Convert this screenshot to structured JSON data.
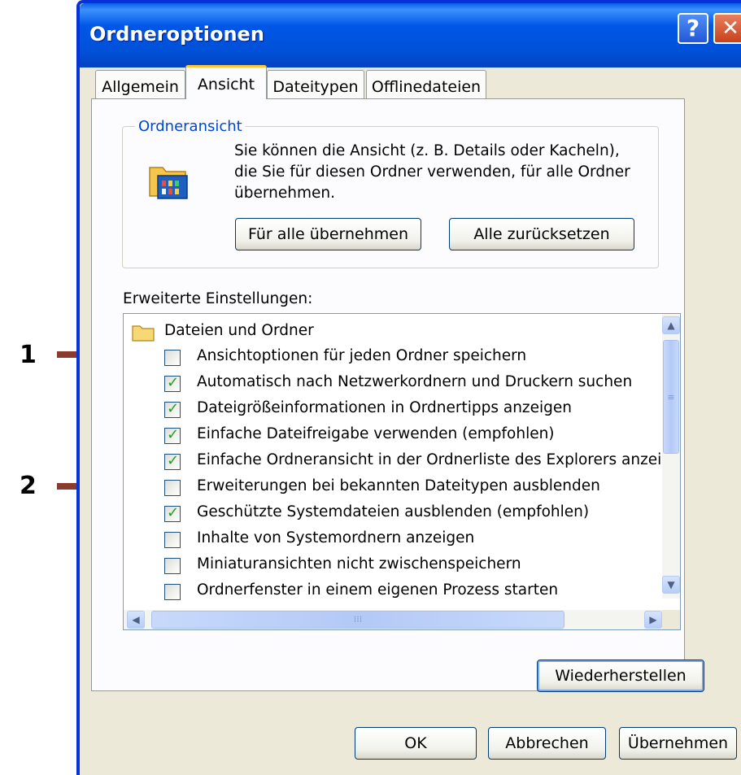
{
  "window": {
    "title": "Ordneroptionen",
    "help_icon": "?",
    "close_icon": "✕"
  },
  "tabs": [
    {
      "label": "Allgemein",
      "active": false
    },
    {
      "label": "Ansicht",
      "active": true
    },
    {
      "label": "Dateitypen",
      "active": false
    },
    {
      "label": "Offlinedateien",
      "active": false
    }
  ],
  "folder_view": {
    "group_label": "Ordneransicht",
    "description_lines": [
      "Sie können die Ansicht (z. B. Details oder Kacheln),",
      "die Sie für diesen Ordner verwenden, für alle Ordner",
      "übernehmen."
    ],
    "apply_all_button": "Für alle übernehmen",
    "reset_all_button": "Alle zurücksetzen"
  },
  "advanced": {
    "label": "Erweiterte Einstellungen:",
    "root_label": "Dateien und Ordner",
    "items": [
      {
        "label": "Ansichtoptionen für jeden Ordner speichern",
        "checked": false
      },
      {
        "label": "Automatisch nach Netzwerkordnern und Druckern suchen",
        "checked": true
      },
      {
        "label": "Dateigrößeinformationen in Ordnertipps anzeigen",
        "checked": true
      },
      {
        "label": "Einfache Dateifreigabe verwenden (empfohlen)",
        "checked": true
      },
      {
        "label": "Einfache Ordneransicht in der Ordnerliste des Explorers anzeige",
        "checked": true
      },
      {
        "label": "Erweiterungen bei bekannten Dateitypen ausblenden",
        "checked": false
      },
      {
        "label": "Geschützte Systemdateien ausblenden (empfohlen)",
        "checked": true
      },
      {
        "label": "Inhalte von Systemordnern anzeigen",
        "checked": false
      },
      {
        "label": "Miniaturansichten nicht zwischenspeichern",
        "checked": false
      },
      {
        "label": "Ordnerfenster in einem eigenen Prozess starten",
        "checked": false
      }
    ]
  },
  "restore_button": "Wiederherstellen",
  "footer": {
    "ok": "OK",
    "cancel": "Abbrechen",
    "apply": "Übernehmen"
  },
  "annotations": [
    "1",
    "2"
  ]
}
